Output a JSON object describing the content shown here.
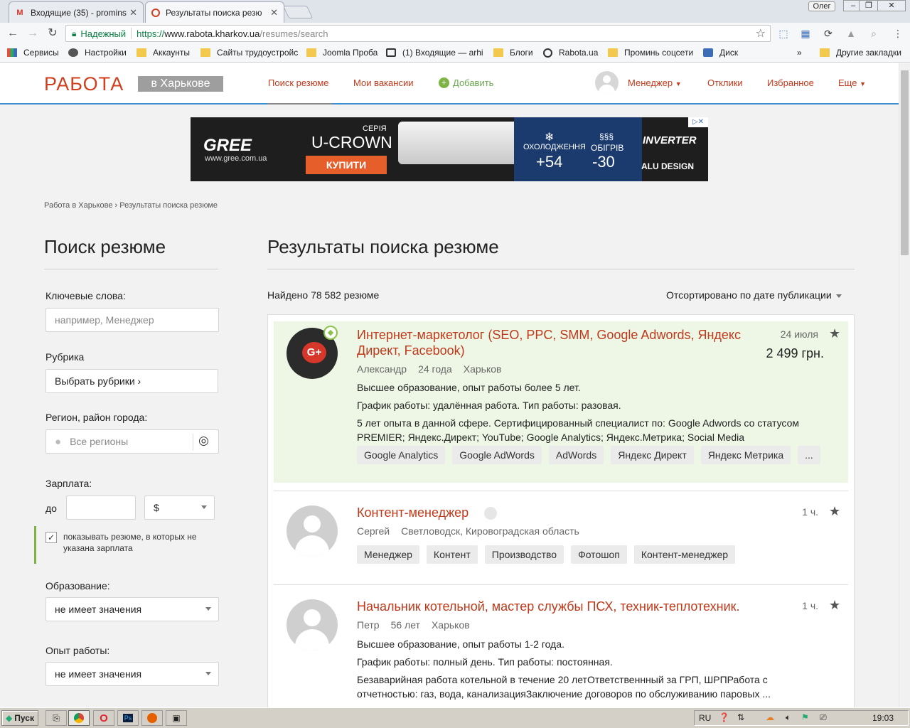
{
  "browser": {
    "tabs": [
      {
        "title": "Входящие (35) - promins",
        "icon": "gmail-icon"
      },
      {
        "title": "Результаты поиска резю",
        "icon": "rabota-icon"
      }
    ],
    "user": "Олег",
    "url": {
      "secure_label": "Надежный",
      "scheme": "https://",
      "host": "www.rabota.kharkov.ua",
      "path": "/resumes/search"
    },
    "bookmarks": [
      "Сервисы",
      "Настройки",
      "Аккаунты",
      "Сайты трудоустройс",
      "Joomla Проба",
      "(1) Входящие — arhi",
      "Блоги",
      "Rabota.ua",
      "Проминь соцсети",
      "Диск"
    ],
    "more_bookmarks": "»",
    "other_bookmarks": "Другие закладки"
  },
  "header": {
    "logo": "РАБОТА",
    "logo_city": "в Харькове",
    "nav": {
      "search": "Поиск резюме",
      "vacancies": "Мои вакансии",
      "add": "Добавить"
    },
    "user_role": "Менеджер",
    "responses": "Отклики",
    "favorites": "Избранное",
    "more": "Еще"
  },
  "ad": {
    "brand": "GREE",
    "site": "www.gree.com.ua",
    "series_label": "СЕРІЯ",
    "series": "U-CROWN",
    "buy": "КУПИТИ",
    "cool_label": "ОХОЛОДЖЕННЯ",
    "cool_value": "+54",
    "heat_label": "ОБІГРІВ",
    "heat_value": "-30",
    "inverter": "INVERTER",
    "alu": "ALU DESIGN"
  },
  "breadcrumb": {
    "home": "Работа в Харькове",
    "sep": "›",
    "current": "Результаты поиска резюме"
  },
  "sidebar": {
    "title": "Поиск резюме",
    "keywords_label": "Ключевые слова:",
    "keywords_placeholder": "например, Менеджер",
    "category_label": "Рубрика",
    "category_value": "Выбрать рубрики ›",
    "region_label": "Регион, район города:",
    "region_value": "Все регионы",
    "salary_label": "Зарплата:",
    "salary_to": "до",
    "currency": "$",
    "no_salary_checkbox": "показывать резюме, в которых не указана зарплата",
    "education_label": "Образование:",
    "education_value": "не имеет значения",
    "experience_label": "Опыт работы:",
    "experience_value": "не имеет значения"
  },
  "main": {
    "title": "Результаты поиска резюме",
    "found": "Найдено 78 582 резюме",
    "sort": "Отсортировано по дате публикации"
  },
  "results": [
    {
      "title": "Интернет-маркетолог (SEO, PPC, SMM, Google Adwords, Яндекс Директ, Facebook)",
      "name": "Александр",
      "age": "24 года",
      "city": "Харьков",
      "date": "24 июля",
      "salary": "2 499 грн.",
      "lines": [
        "Высшее образование, опыт работы более 5 лет.",
        "График работы: удалённая работа. Тип работы: разовая.",
        "5 лет опыта в данной сфере. Сертифицированный специалист по: Google Adwords со статусом PREMIER; Яндекс.Директ; YouTube; Google Analytics; Яндекс.Метрика; Social Media"
      ],
      "tags": [
        "Google Analytics",
        "Google AdWords",
        "AdWords",
        "Яндекс Директ",
        "Яндекс Метрика",
        "..."
      ]
    },
    {
      "title": "Контент-менеджер",
      "name": "Сергей",
      "city": "Светловодск, Кировоградская область",
      "date": "1 ч.",
      "tags": [
        "Менеджер",
        "Контент",
        "Производство",
        "Фотошоп",
        "Контент-менеджер"
      ]
    },
    {
      "title": "Начальник котельной, мастер службы ПСХ, техник-теплотехник.",
      "name": "Петр",
      "age": "56 лет",
      "city": "Харьков",
      "date": "1 ч.",
      "lines": [
        "Высшее образование, опыт работы 1-2 года.",
        "График работы: полный день. Тип работы: постоянная.",
        "Безаварийная работа котельной в течение 20 летОтветственнный за ГРП, ШРПРабота с отчетностью: газ, вода, канализацияЗаключение договоров по обслуживанию паровых ..."
      ]
    }
  ],
  "taskbar": {
    "start": "Пуск",
    "lang": "RU",
    "time": "19:03"
  }
}
